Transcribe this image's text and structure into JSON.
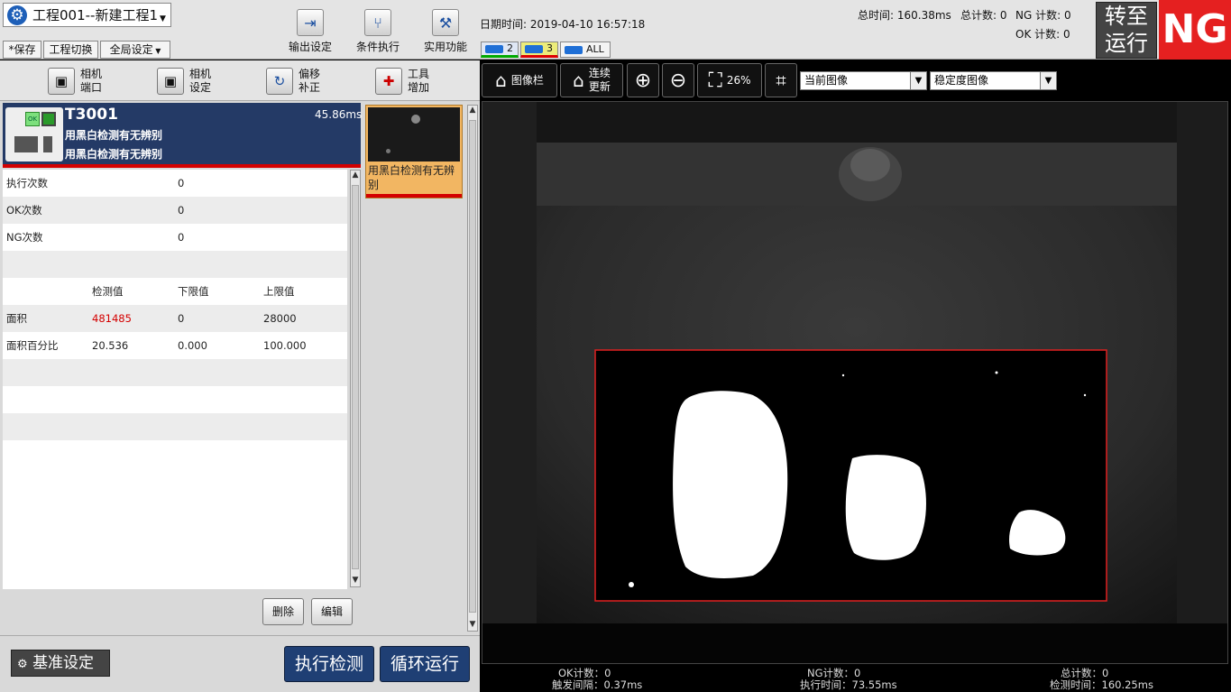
{
  "header": {
    "project": "工程001--新建工程1",
    "save": "*保存",
    "switch_project": "工程切换",
    "global_settings": "全局设定",
    "output_settings": "输出设定",
    "condition_exec": "条件执行",
    "utility": "实用功能",
    "datetime": "日期时间: 2019-04-10 16:57:18",
    "total_time": "总时间: 160.38ms",
    "total_count": "总计数: 0",
    "ng_count": "NG 计数: 0",
    "ok_count": "OK 计数: 0",
    "cam_tabs": [
      "2",
      "3",
      "ALL"
    ],
    "switch_line1": "转至",
    "switch_line2": "运行",
    "result": "NG"
  },
  "left_tools": [
    {
      "line1": "相机",
      "line2": "端口"
    },
    {
      "line1": "相机",
      "line2": "设定"
    },
    {
      "line1": "偏移",
      "line2": "补正"
    },
    {
      "line1": "工具",
      "line2": "增加"
    }
  ],
  "tool_card": {
    "id": "T3001",
    "time": "45.86ms",
    "name1": "用黑白检测有无辨别",
    "name2": "用黑白检测有无辨别",
    "thumb_ok": "OK"
  },
  "tool_list": {
    "label": "用黑白检测有无辨别"
  },
  "stats": [
    {
      "label": "执行次数",
      "value": "0"
    },
    {
      "label": "OK次数",
      "value": "0"
    },
    {
      "label": "NG次数",
      "value": "0"
    }
  ],
  "measure": {
    "headers": [
      "检测值",
      "下限值",
      "上限值"
    ],
    "rows": [
      {
        "label": "面积",
        "value": "481485",
        "low": "0",
        "high": "28000",
        "value_color": "#d40000"
      },
      {
        "label": "面积百分比",
        "value": "20.536",
        "low": "0.000",
        "high": "100.000",
        "value_color": "#222222"
      }
    ]
  },
  "actions": {
    "delete": "删除",
    "edit": "编辑",
    "baseline": "基准设定",
    "execute": "执行检测",
    "loop": "循环运行"
  },
  "image_toolbar": {
    "image_bar": "图像栏",
    "continuous1": "连续",
    "continuous2": "更新",
    "zoom": "26%",
    "current_image": "当前图像",
    "stable_image": "稳定度图像"
  },
  "status": {
    "ok": "OK计数：0",
    "ng": "NG计数：0",
    "total": "总计数：0",
    "trigger": "触发间隔：0.37ms",
    "exec": "执行时间：73.55ms",
    "detect": "检测时间：160.25ms"
  },
  "colors": {
    "accent_blue": "#1f3f74",
    "ng_red": "#e52020",
    "roi_red": "#e02020"
  }
}
